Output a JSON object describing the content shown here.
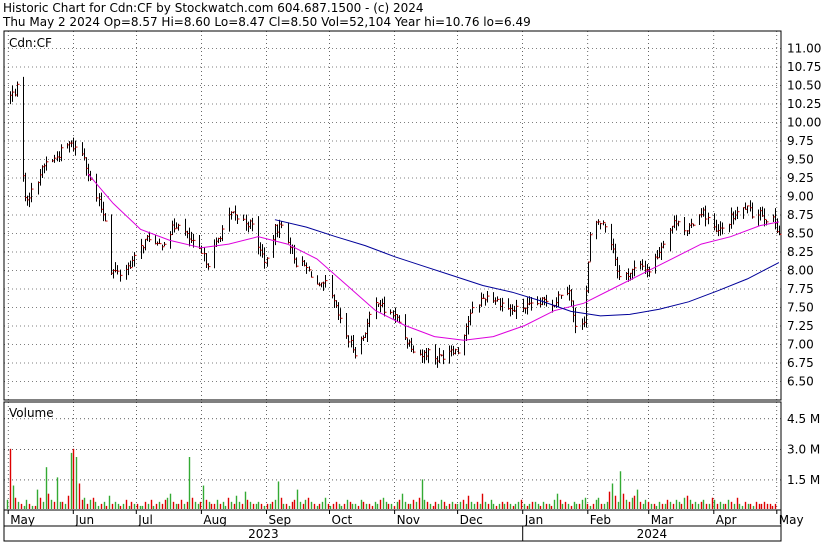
{
  "header": {
    "line1": "Historic Chart for Cdn:CF by Stockwatch.com 604.687.1500 - (c) 2024",
    "line2": "Thu May  2 2024  Op=8.57  Hi=8.60  Lo=8.47  Cl=8.50  Vol=52,104  Year hi=10.76  lo=6.49"
  },
  "colors": {
    "background": "#ffffff",
    "gridline": "#000000",
    "price_bar": "#000000",
    "price_tick": "#cc0000",
    "ma_short": "#dd00dd",
    "ma_long": "#000099",
    "volume_up": "#33aa33",
    "volume_down": "#dd0000"
  },
  "chart_data": [
    {
      "type": "line",
      "panel": "price",
      "title": "Cdn:CF",
      "style": "OHLC bars with two moving averages",
      "ylim": [
        6.25,
        11.25
      ],
      "y_ticks": [
        "11.00",
        "10.75",
        "10.50",
        "10.25",
        "10.00",
        "9.75",
        "9.50",
        "9.25",
        "9.00",
        "8.75",
        "8.50",
        "8.25",
        "8.00",
        "7.75",
        "7.50",
        "7.25",
        "7.00",
        "6.75",
        "6.50"
      ],
      "grid": true,
      "x_month_labels": [
        "May",
        "Jun",
        "Jul",
        "Aug",
        "Sep",
        "Oct",
        "Nov",
        "Dec",
        "Jan",
        "Feb",
        "Mar",
        "Apr",
        "May"
      ],
      "x_year_labels": [
        "2023",
        "2024"
      ],
      "price_path": [
        [
          "2023-05-02",
          10.35
        ],
        [
          "2023-05-05",
          10.45
        ],
        [
          "2023-05-09",
          8.95
        ],
        [
          "2023-05-12",
          9.05
        ],
        [
          "2023-05-16",
          9.3
        ],
        [
          "2023-05-19",
          9.45
        ],
        [
          "2023-05-23",
          9.5
        ],
        [
          "2023-05-26",
          9.6
        ],
        [
          "2023-05-30",
          9.7
        ],
        [
          "2023-06-02",
          9.65
        ],
        [
          "2023-06-06",
          9.55
        ],
        [
          "2023-06-09",
          9.2
        ],
        [
          "2023-06-13",
          8.9
        ],
        [
          "2023-06-16",
          8.7
        ],
        [
          "2023-06-19",
          8.0
        ],
        [
          "2023-06-23",
          7.95
        ],
        [
          "2023-06-27",
          8.05
        ],
        [
          "2023-06-30",
          8.15
        ],
        [
          "2023-07-04",
          8.35
        ],
        [
          "2023-07-07",
          8.45
        ],
        [
          "2023-07-11",
          8.3
        ],
        [
          "2023-07-14",
          8.4
        ],
        [
          "2023-07-18",
          8.55
        ],
        [
          "2023-07-21",
          8.65
        ],
        [
          "2023-07-25",
          8.45
        ],
        [
          "2023-07-28",
          8.35
        ],
        [
          "2023-08-01",
          8.2
        ],
        [
          "2023-08-04",
          8.1
        ],
        [
          "2023-08-08",
          8.35
        ],
        [
          "2023-08-11",
          8.55
        ],
        [
          "2023-08-15",
          8.75
        ],
        [
          "2023-08-18",
          8.7
        ],
        [
          "2023-08-22",
          8.65
        ],
        [
          "2023-08-25",
          8.6
        ],
        [
          "2023-08-29",
          8.25
        ],
        [
          "2023-09-01",
          8.1
        ],
        [
          "2023-09-05",
          8.55
        ],
        [
          "2023-09-08",
          8.6
        ],
        [
          "2023-09-12",
          8.35
        ],
        [
          "2023-09-15",
          8.1
        ],
        [
          "2023-09-19",
          8.05
        ],
        [
          "2023-09-22",
          7.95
        ],
        [
          "2023-09-26",
          7.75
        ],
        [
          "2023-09-29",
          7.8
        ],
        [
          "2023-10-03",
          7.55
        ],
        [
          "2023-10-06",
          7.3
        ],
        [
          "2023-10-10",
          7.05
        ],
        [
          "2023-10-13",
          6.9
        ],
        [
          "2023-10-17",
          7.1
        ],
        [
          "2023-10-20",
          7.35
        ],
        [
          "2023-10-24",
          7.6
        ],
        [
          "2023-10-27",
          7.45
        ],
        [
          "2023-10-31",
          7.4
        ],
        [
          "2023-11-03",
          7.3
        ],
        [
          "2023-11-07",
          7.05
        ],
        [
          "2023-11-10",
          6.95
        ],
        [
          "2023-11-14",
          6.85
        ],
        [
          "2023-11-17",
          6.9
        ],
        [
          "2023-11-21",
          6.8
        ],
        [
          "2023-11-24",
          6.85
        ],
        [
          "2023-11-28",
          6.95
        ],
        [
          "2023-12-01",
          6.9
        ],
        [
          "2023-12-05",
          7.25
        ],
        [
          "2023-12-08",
          7.45
        ],
        [
          "2023-12-12",
          7.6
        ],
        [
          "2023-12-15",
          7.65
        ],
        [
          "2023-12-19",
          7.6
        ],
        [
          "2023-12-22",
          7.55
        ],
        [
          "2023-12-27",
          7.45
        ],
        [
          "2024-01-02",
          7.5
        ],
        [
          "2024-01-05",
          7.5
        ],
        [
          "2024-01-09",
          7.55
        ],
        [
          "2024-01-12",
          7.6
        ],
        [
          "2024-01-16",
          7.55
        ],
        [
          "2024-01-19",
          7.7
        ],
        [
          "2024-01-23",
          7.75
        ],
        [
          "2024-01-26",
          7.2
        ],
        [
          "2024-01-30",
          7.35
        ],
        [
          "2024-02-02",
          8.45
        ],
        [
          "2024-02-06",
          8.65
        ],
        [
          "2024-02-09",
          8.6
        ],
        [
          "2024-02-13",
          8.3
        ],
        [
          "2024-02-16",
          7.9
        ],
        [
          "2024-02-20",
          7.95
        ],
        [
          "2024-02-23",
          8.0
        ],
        [
          "2024-02-27",
          8.05
        ],
        [
          "2024-03-01",
          8.0
        ],
        [
          "2024-03-05",
          8.2
        ],
        [
          "2024-03-08",
          8.4
        ],
        [
          "2024-03-12",
          8.6
        ],
        [
          "2024-03-15",
          8.7
        ],
        [
          "2024-03-19",
          8.5
        ],
        [
          "2024-03-22",
          8.65
        ],
        [
          "2024-03-26",
          8.8
        ],
        [
          "2024-03-29",
          8.7
        ],
        [
          "2024-04-02",
          8.5
        ],
        [
          "2024-04-05",
          8.55
        ],
        [
          "2024-04-09",
          8.7
        ],
        [
          "2024-04-12",
          8.75
        ],
        [
          "2024-04-16",
          8.85
        ],
        [
          "2024-04-19",
          8.75
        ],
        [
          "2024-04-23",
          8.8
        ],
        [
          "2024-04-26",
          8.7
        ],
        [
          "2024-04-30",
          8.65
        ],
        [
          "2024-05-02",
          8.5
        ]
      ],
      "series": [
        {
          "points": [
            [
              "2023-06-08",
              9.3
            ],
            [
              "2023-06-20",
              8.9
            ],
            [
              "2023-07-03",
              8.55
            ],
            [
              "2023-07-17",
              8.4
            ],
            [
              "2023-08-01",
              8.3
            ],
            [
              "2023-08-14",
              8.35
            ],
            [
              "2023-08-28",
              8.45
            ],
            [
              "2023-09-11",
              8.35
            ],
            [
              "2023-09-25",
              8.15
            ],
            [
              "2023-10-09",
              7.8
            ],
            [
              "2023-10-23",
              7.45
            ],
            [
              "2023-11-06",
              7.25
            ],
            [
              "2023-11-20",
              7.1
            ],
            [
              "2023-12-04",
              7.05
            ],
            [
              "2023-12-18",
              7.1
            ],
            [
              "2024-01-02",
              7.25
            ],
            [
              "2024-01-16",
              7.45
            ],
            [
              "2024-01-30",
              7.55
            ],
            [
              "2024-02-13",
              7.75
            ],
            [
              "2024-02-27",
              7.95
            ],
            [
              "2024-03-12",
              8.15
            ],
            [
              "2024-03-26",
              8.35
            ],
            [
              "2024-04-09",
              8.45
            ],
            [
              "2024-04-23",
              8.6
            ],
            [
              "2024-05-02",
              8.65
            ]
          ]
        },
        {
          "points": [
            [
              "2023-09-05",
              8.68
            ],
            [
              "2023-09-20",
              8.58
            ],
            [
              "2023-10-04",
              8.45
            ],
            [
              "2023-10-18",
              8.33
            ],
            [
              "2023-11-01",
              8.18
            ],
            [
              "2023-11-15",
              8.05
            ],
            [
              "2023-11-29",
              7.92
            ],
            [
              "2023-12-13",
              7.79
            ],
            [
              "2023-12-27",
              7.7
            ],
            [
              "2024-01-10",
              7.58
            ],
            [
              "2024-01-24",
              7.44
            ],
            [
              "2024-02-07",
              7.38
            ],
            [
              "2024-02-21",
              7.4
            ],
            [
              "2024-03-06",
              7.47
            ],
            [
              "2024-03-20",
              7.57
            ],
            [
              "2024-04-03",
              7.72
            ],
            [
              "2024-04-17",
              7.88
            ],
            [
              "2024-05-02",
              8.1
            ]
          ]
        }
      ]
    },
    {
      "type": "bar",
      "panel": "volume",
      "title": "Volume",
      "ylim": [
        0,
        5.2
      ],
      "y_ticks": [
        "4.5 M",
        "3.0 M",
        "1.5 M"
      ],
      "unit": "M",
      "grid": true,
      "values": [
        0.5,
        3.0,
        1.2,
        0.6,
        0.4,
        0.3,
        0.2,
        0.5,
        0.3,
        0.2,
        0.2,
        1.0,
        0.6,
        0.4,
        2.1,
        0.8,
        0.5,
        0.4,
        1.6,
        0.4,
        0.4,
        0.3,
        0.7,
        2.8,
        3.0,
        2.6,
        1.3,
        0.5,
        0.6,
        0.3,
        0.5,
        0.6,
        0.4,
        0.2,
        0.3,
        0.4,
        0.2,
        0.7,
        0.3,
        0.4,
        0.3,
        0.2,
        0.3,
        0.5,
        0.2,
        0.4,
        0.3,
        0.3,
        0.2,
        0.2,
        0.4,
        0.3,
        0.5,
        0.2,
        0.3,
        0.4,
        0.3,
        0.5,
        0.6,
        0.8,
        0.4,
        0.3,
        0.3,
        0.5,
        0.3,
        0.4,
        2.6,
        0.6,
        0.4,
        0.3,
        0.4,
        1.2,
        0.5,
        0.4,
        0.3,
        0.3,
        0.5,
        0.3,
        0.4,
        0.2,
        0.6,
        0.4,
        0.3,
        0.7,
        0.4,
        0.3,
        0.9,
        0.5,
        0.4,
        0.3,
        0.3,
        0.4,
        0.3,
        0.2,
        0.3,
        0.3,
        0.4,
        0.5,
        1.4,
        0.6,
        0.3,
        0.3,
        0.2,
        0.4,
        0.5,
        1.0,
        0.4,
        0.3,
        0.5,
        0.6,
        0.4,
        0.3,
        0.2,
        0.3,
        0.4,
        0.6,
        0.3,
        0.2,
        0.3,
        0.4,
        0.3,
        0.2,
        0.3,
        0.5,
        0.4,
        0.3,
        0.3,
        0.2,
        0.5,
        0.4,
        0.3,
        0.3,
        0.2,
        0.4,
        0.3,
        0.5,
        0.6,
        0.4,
        0.3,
        0.3,
        0.2,
        0.4,
        0.5,
        0.8,
        0.4,
        0.3,
        0.3,
        0.5,
        0.4,
        0.6,
        1.5,
        0.5,
        0.4,
        0.3,
        0.2,
        0.4,
        0.3,
        0.5,
        0.4,
        0.2,
        0.3,
        0.4,
        0.3,
        0.3,
        0.4,
        0.5,
        0.3,
        0.7,
        0.4,
        0.3,
        0.4,
        0.3,
        0.8,
        0.4,
        0.3,
        0.5,
        0.3,
        0.2,
        0.3,
        0.4,
        0.3,
        0.4,
        0.3,
        0.2,
        0.3,
        0.4,
        0.5,
        0.3,
        0.2,
        0.3,
        0.4,
        0.4,
        0.3,
        0.2,
        0.4,
        0.3,
        0.3,
        0.2,
        0.5,
        0.8,
        0.5,
        0.3,
        0.4,
        0.3,
        0.2,
        0.4,
        0.3,
        0.3,
        0.5,
        0.6,
        0.3,
        0.2,
        0.3,
        0.5,
        0.6,
        0.3,
        0.3,
        0.4,
        0.9,
        1.3,
        0.7,
        0.4,
        1.9,
        0.8,
        0.5,
        0.4,
        0.6,
        0.7,
        1.0,
        0.4,
        0.3,
        0.5,
        0.4,
        0.3,
        0.3,
        0.2,
        0.4,
        0.3,
        0.3,
        0.5,
        0.4,
        0.3,
        0.5,
        0.4,
        0.3,
        0.6,
        0.7,
        0.5,
        0.3,
        0.4,
        0.3,
        0.4,
        0.5,
        0.3,
        0.3,
        0.6,
        0.5,
        0.3,
        0.4,
        0.3,
        0.3,
        0.5,
        0.4,
        0.3,
        0.6,
        0.3,
        0.2,
        0.4,
        0.3,
        0.3,
        0.2,
        0.4,
        0.3,
        0.3,
        0.4,
        0.3,
        0.3,
        0.2,
        0.3
      ],
      "bar_colors": [
        "g",
        "r",
        "g",
        "r",
        "g",
        "r",
        "g",
        "g",
        "r",
        "g",
        "r",
        "g",
        "r",
        "g",
        "g",
        "r",
        "g",
        "r",
        "g",
        "g",
        "r",
        "g",
        "r",
        "g",
        "r",
        "g",
        "r",
        "r",
        "g",
        "r",
        "g",
        "r",
        "g",
        "g",
        "r",
        "g",
        "r",
        "g",
        "r",
        "g",
        "g",
        "r",
        "g",
        "r",
        "g",
        "r",
        "g",
        "r",
        "g",
        "g",
        "r",
        "g",
        "r",
        "g",
        "r",
        "g",
        "r",
        "r",
        "g",
        "g",
        "r",
        "g",
        "r",
        "r",
        "g",
        "r",
        "g",
        "r",
        "g",
        "g",
        "r",
        "g",
        "r",
        "g",
        "r",
        "r",
        "g",
        "r",
        "g",
        "g",
        "r",
        "g",
        "r",
        "g",
        "g",
        "r",
        "g",
        "r",
        "g",
        "r",
        "g",
        "g",
        "r",
        "g",
        "r",
        "g",
        "r",
        "g",
        "g",
        "r",
        "g",
        "r",
        "g",
        "r",
        "r",
        "g",
        "g",
        "r",
        "g",
        "r",
        "g",
        "r",
        "g",
        "r",
        "g",
        "g",
        "r",
        "g",
        "r",
        "r",
        "g",
        "g",
        "r",
        "g",
        "r",
        "g",
        "g",
        "r",
        "g",
        "r",
        "g",
        "r",
        "r",
        "g",
        "g",
        "r",
        "g",
        "g",
        "r",
        "g",
        "r",
        "g",
        "r",
        "g",
        "g",
        "r",
        "g",
        "r",
        "g",
        "r",
        "g",
        "g",
        "r",
        "g",
        "r",
        "r",
        "g",
        "g",
        "r",
        "g",
        "r",
        "g",
        "r",
        "g",
        "g",
        "r",
        "g",
        "r",
        "g",
        "g",
        "r",
        "g",
        "r",
        "g",
        "r",
        "g",
        "g",
        "r",
        "g",
        "r",
        "g",
        "r",
        "g",
        "r",
        "g",
        "g",
        "r",
        "g",
        "r",
        "g",
        "r",
        "g",
        "g",
        "r",
        "g",
        "r",
        "g",
        "r",
        "g",
        "g",
        "r",
        "g",
        "r",
        "g",
        "r",
        "g",
        "g",
        "r",
        "g",
        "g",
        "r",
        "g",
        "r",
        "g",
        "g",
        "r",
        "g",
        "g",
        "r",
        "g",
        "r",
        "g",
        "g",
        "r",
        "g",
        "r",
        "g",
        "r",
        "g",
        "r",
        "g",
        "g",
        "r",
        "g",
        "r",
        "g",
        "g",
        "r",
        "g",
        "r",
        "g",
        "r",
        "g",
        "g",
        "r",
        "g",
        "r",
        "g",
        "r",
        "g",
        "g",
        "r",
        "g",
        "r",
        "g",
        "r",
        "g",
        "r",
        "g",
        "g",
        "r",
        "g",
        "r",
        "g",
        "r",
        "g",
        "g",
        "r",
        "g",
        "r",
        "g"
      ]
    }
  ]
}
